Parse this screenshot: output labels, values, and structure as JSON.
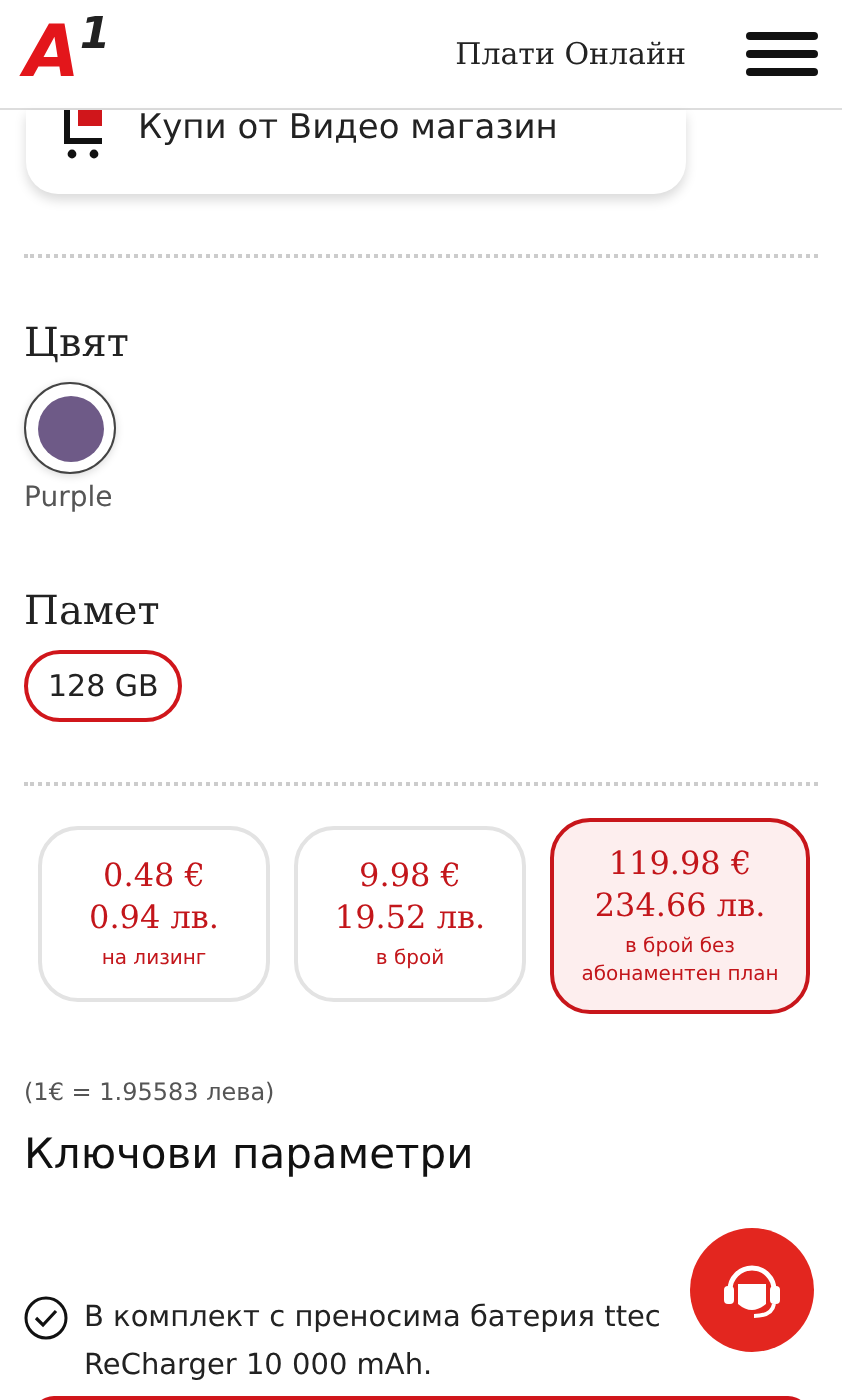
{
  "header": {
    "logo": "A",
    "logo_digit": "1",
    "pay_link": "Плати Онлайн"
  },
  "shop_card": {
    "label": "Купи от Видео магазин"
  },
  "color_section": {
    "title": "Цвят",
    "options": [
      {
        "name": "Purple",
        "color": "#6e5a87",
        "selected": true
      }
    ]
  },
  "memory_section": {
    "title": "Памет",
    "options": [
      {
        "label": "128 GB",
        "selected": true
      }
    ]
  },
  "prices": [
    {
      "eur": "0.48 €",
      "bgn": "0.94 лв.",
      "note": "на лизинг",
      "selected": false
    },
    {
      "eur": "9.98 €",
      "bgn": "19.52 лв.",
      "note": "в брой",
      "selected": false
    },
    {
      "eur": "119.98 €",
      "bgn": "234.66 лв.",
      "note": "в брой без абонаментен план",
      "selected": true
    }
  ],
  "rate_note": "(1€ = 1.95583 лева)",
  "key_params": {
    "title": "Ключови параметри",
    "items": [
      {
        "text": "В комплект с преносима батерия ttec ReCharger 10 000 mAh."
      }
    ]
  }
}
